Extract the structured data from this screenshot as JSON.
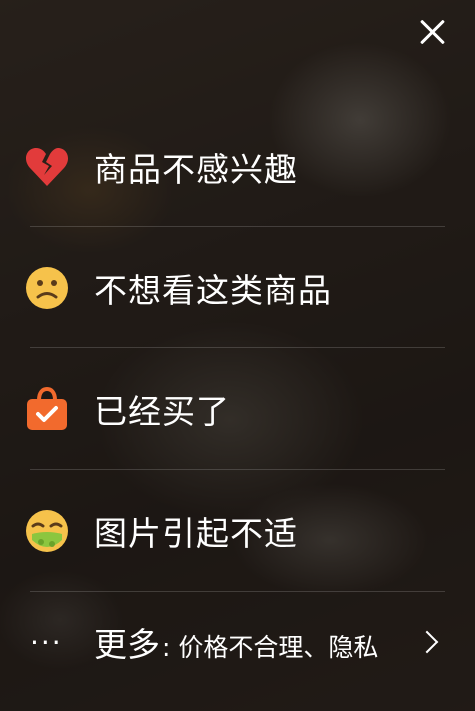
{
  "options": [
    {
      "icon": "broken-heart-icon",
      "label": "商品不感兴趣"
    },
    {
      "icon": "sad-face-icon",
      "label": "不想看这类商品"
    },
    {
      "icon": "shopping-bag-check-icon",
      "label": "已经买了"
    },
    {
      "icon": "nauseated-face-icon",
      "label": "图片引起不适"
    }
  ],
  "more": {
    "icon": "more-dots-icon",
    "dots": "···",
    "label": "更多",
    "detail": ": 价格不合理、隐私"
  },
  "colors": {
    "heart": "#e23b3b",
    "face": "#f6c24b",
    "bag": "#f26a2d",
    "sick": "#8cc63f"
  }
}
